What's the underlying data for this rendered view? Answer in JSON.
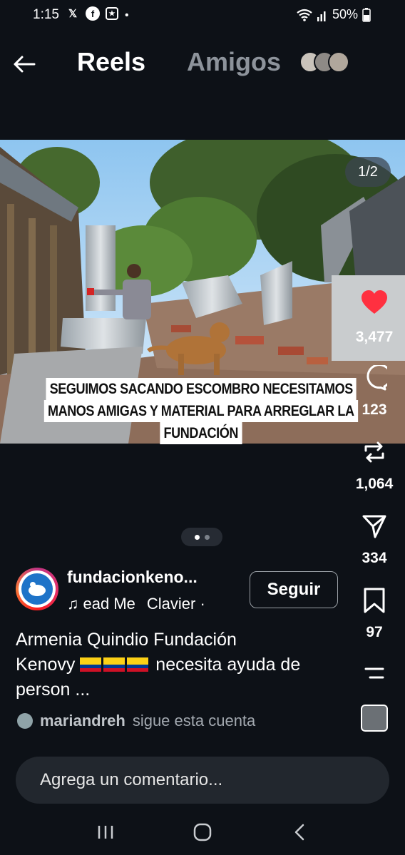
{
  "status_bar": {
    "time": "1:15",
    "left_icons": [
      "x-icon",
      "facebook-icon",
      "app-icon"
    ],
    "dot": "•",
    "battery": "50%"
  },
  "header": {
    "tabs": [
      {
        "label": "Reels",
        "active": true
      },
      {
        "label": "Amigos",
        "active": false
      }
    ]
  },
  "post": {
    "counter": "1/2",
    "caption_lines": [
      "SEGUIMOS SACANDO ESCOMBRO NECESITAMOS",
      "MANOS AMIGAS Y MATERIAL PARA ARREGLAR LA",
      "FUNDACIÓN"
    ],
    "pages": 2,
    "current_page": 1
  },
  "actions": {
    "likes": "3,477",
    "comments": "123",
    "reposts": "1,064",
    "shares": "334",
    "saves": "97"
  },
  "profile": {
    "username": "fundacionkeno...",
    "music": "ead Me",
    "artist": "Clavier ·",
    "follow_label": "Seguir"
  },
  "description": {
    "line1": "Armenia Quindio Fundación",
    "line2a": "Kenovy",
    "line2b": "necesita ayuda de",
    "line3": "person ..."
  },
  "followed_by": {
    "name": "mariandreh",
    "text": "sigue esta cuenta"
  },
  "comment": {
    "placeholder": "Agrega un comentario..."
  },
  "colors": {
    "background": "#0d1117",
    "like": "#ff3040",
    "inactive_tab": "#8d939b"
  }
}
